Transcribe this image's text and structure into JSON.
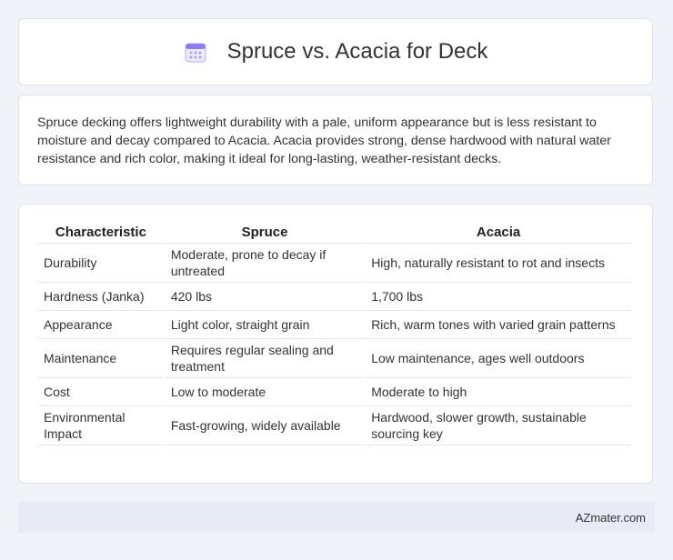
{
  "header": {
    "title": "Spruce vs. Acacia for Deck",
    "icon": "calendar-icon"
  },
  "intro": {
    "text": "Spruce decking offers lightweight durability with a pale, uniform appearance but is less resistant to moisture and decay compared to Acacia. Acacia provides strong, dense hardwood with natural water resistance and rich color, making it ideal for long-lasting, weather-resistant decks."
  },
  "table": {
    "headers": [
      "Characteristic",
      "Spruce",
      "Acacia"
    ],
    "rows": [
      [
        "Durability",
        "Moderate, prone to decay if untreated",
        "High, naturally resistant to rot and insects"
      ],
      [
        "Hardness (Janka)",
        "420 lbs",
        "1,700 lbs"
      ],
      [
        "Appearance",
        "Light color, straight grain",
        "Rich, warm tones with varied grain patterns"
      ],
      [
        "Maintenance",
        "Requires regular sealing and treatment",
        "Low maintenance, ages well outdoors"
      ],
      [
        "Cost",
        "Low to moderate",
        "Moderate to high"
      ],
      [
        "Environmental Impact",
        "Fast-growing, widely available",
        "Hardwood, slower growth, sustainable sourcing key"
      ]
    ]
  },
  "footer": {
    "brand": "AZmater.com"
  },
  "colors": {
    "background": "#f0f3f8",
    "footer": "#e6ebf5",
    "icon": "#8a7ff0"
  }
}
